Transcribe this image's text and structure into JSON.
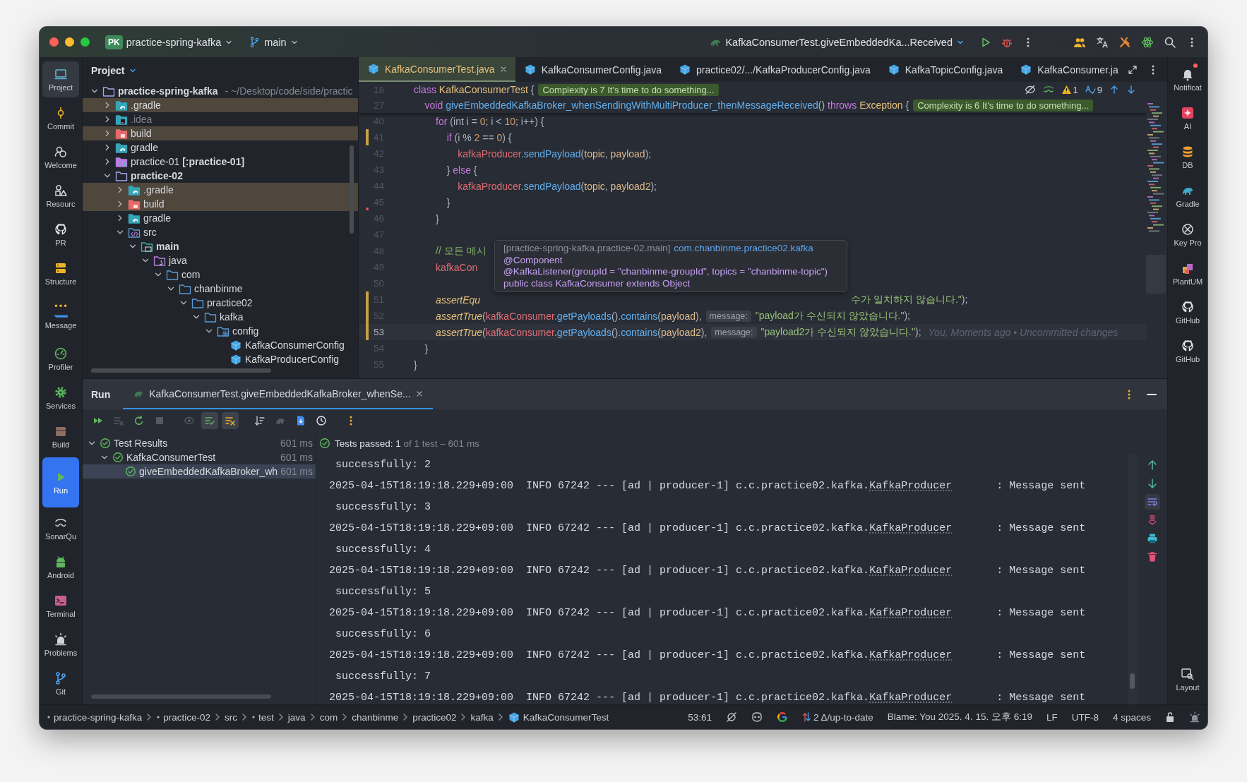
{
  "title_bar": {
    "project_badge": "PK",
    "project": "practice-spring-kafka",
    "branch": "main",
    "run_config": "KafkaConsumerTest.giveEmbeddedKa...Received"
  },
  "left_toolbar": [
    {
      "label": "Project",
      "selected": true
    },
    {
      "label": "Commit",
      "selected": false
    },
    {
      "label": "Welcome",
      "selected": false
    },
    {
      "label": "Resourc",
      "selected": false
    },
    {
      "label": "PR",
      "selected": false
    },
    {
      "label": "Structure",
      "selected": false
    },
    {
      "label": "Message",
      "selected": false
    },
    {
      "label": "Profiler",
      "selected": false
    },
    {
      "label": "Services",
      "selected": false
    },
    {
      "label": "Build",
      "selected": false
    },
    {
      "label": "Run",
      "selected": true
    },
    {
      "label": "SonarQu",
      "selected": false
    },
    {
      "label": "Android",
      "selected": false
    },
    {
      "label": "Terminal",
      "selected": false
    },
    {
      "label": "Problems",
      "selected": false
    },
    {
      "label": "Git",
      "selected": false
    }
  ],
  "right_toolbar": [
    {
      "label": "Notificat",
      "unread": true
    },
    {
      "label": "AI",
      "unread": false
    },
    {
      "label": "DB",
      "unread": false
    },
    {
      "label": "Gradle",
      "unread": false
    },
    {
      "label": "Key Pro",
      "unread": false
    },
    {
      "label": "PlantUM",
      "unread": false
    },
    {
      "label": "GitHub",
      "unread": false
    },
    {
      "label": "GitHub",
      "unread": false
    }
  ],
  "layout_button": "Layout",
  "project_panel": {
    "title": "Project",
    "tree": [
      {
        "kind": "project",
        "label": "practice-spring-kafka",
        "path": "- ~/Desktop/code/side/practic",
        "expanded": true,
        "excluded": false,
        "ignored": false,
        "children": [
          {
            "kind": "gradle_folder",
            "label": ".gradle",
            "expanded": false,
            "excluded": true,
            "ignored": false
          },
          {
            "kind": "idea_folder",
            "label": ".idea",
            "expanded": false,
            "excluded": false,
            "ignored": true
          },
          {
            "kind": "build_folder",
            "label": "build",
            "expanded": false,
            "excluded": true,
            "ignored": false
          },
          {
            "kind": "gradle_folder",
            "label": "gradle",
            "expanded": false,
            "excluded": false,
            "ignored": false
          },
          {
            "kind": "module_ref",
            "label": "practice-01 **[:practice-01]**",
            "expanded": false,
            "excluded": false,
            "ignored": false
          },
          {
            "kind": "module",
            "label": "practice-02",
            "expanded": true,
            "excluded": false,
            "ignored": false,
            "children": [
              {
                "kind": "gradle_folder",
                "label": ".gradle",
                "expanded": false,
                "excluded": true,
                "ignored": false
              },
              {
                "kind": "build_folder",
                "label": "build",
                "expanded": false,
                "excluded": true,
                "ignored": false
              },
              {
                "kind": "gradle_folder",
                "label": "gradle",
                "expanded": false,
                "excluded": false,
                "ignored": false
              },
              {
                "kind": "src",
                "label": "src",
                "expanded": true,
                "excluded": false,
                "ignored": false,
                "children": [
                  {
                    "kind": "source_set",
                    "label": "main",
                    "expanded": true,
                    "excluded": false,
                    "ignored": false,
                    "children": [
                      {
                        "kind": "java",
                        "label": "java",
                        "expanded": true,
                        "excluded": false,
                        "ignored": false,
                        "children": [
                          {
                            "kind": "package",
                            "label": "com",
                            "expanded": true,
                            "excluded": false,
                            "ignored": false,
                            "children": [
                              {
                                "kind": "package",
                                "label": "chanbinme",
                                "expanded": true,
                                "excluded": false,
                                "ignored": false,
                                "children": [
                                  {
                                    "kind": "package",
                                    "label": "practice02",
                                    "expanded": true,
                                    "excluded": false,
                                    "ignored": false,
                                    "children": [
                                      {
                                        "kind": "package",
                                        "label": "kafka",
                                        "expanded": true,
                                        "excluded": false,
                                        "ignored": false,
                                        "children": [
                                          {
                                            "kind": "config",
                                            "label": "config",
                                            "expanded": true,
                                            "excluded": false,
                                            "ignored": false,
                                            "children": [
                                              {
                                                "kind": "class",
                                                "label": "KafkaConsumerConfig",
                                                "excluded": false,
                                                "ignored": false
                                              },
                                              {
                                                "kind": "class",
                                                "label": "KafkaProducerConfig",
                                                "excluded": false,
                                                "ignored": false
                                              }
                                            ]
                                          }
                                        ]
                                      }
                                    ]
                                  }
                                ]
                              }
                            ]
                          }
                        ]
                      }
                    ]
                  }
                ]
              }
            ]
          }
        ]
      }
    ]
  },
  "editor": {
    "tabs": [
      {
        "label": "KafkaConsumerTest.java",
        "selected": true
      },
      {
        "label": "KafkaConsumerConfig.java",
        "selected": false
      },
      {
        "label": "practice02/.../KafkaProducerConfig.java",
        "selected": false
      },
      {
        "label": "KafkaTopicConfig.java",
        "selected": false
      },
      {
        "label": "KafkaConsumer.ja",
        "selected": false
      }
    ],
    "inspections": {
      "warnings": "1",
      "typos": "9"
    },
    "sticky_lines": [
      {
        "number": "18",
        "tokens": [
          {
            "kind": "kw",
            "text": "class "
          },
          {
            "kind": "type",
            "text": "KafkaConsumerTest "
          },
          {
            "kind": "p",
            "text": "{"
          },
          {
            "kind": "badge",
            "text": "Complexity is 7 It's time to do something..."
          }
        ]
      },
      {
        "number": "27",
        "tokens": [
          {
            "kind": "kw",
            "text": "    void "
          },
          {
            "kind": "fn",
            "text": "giveEmbeddedKafkaBroker_whenSendingWithMultiProducer_thenMessageReceived"
          },
          {
            "kind": "p",
            "text": "() "
          },
          {
            "kind": "kw",
            "text": "throws "
          },
          {
            "kind": "type",
            "text": "Exception "
          },
          {
            "kind": "p",
            "text": "{"
          },
          {
            "kind": "badge",
            "text": "Complexity is 6 It's time to do something..."
          }
        ]
      }
    ],
    "lines": [
      {
        "number": "40",
        "modified": false,
        "deleted": false,
        "current": false,
        "tokens": [
          {
            "kind": "kw",
            "text": "        for "
          },
          {
            "kind": "p",
            "text": "(int i = "
          },
          {
            "kind": "num",
            "text": "0"
          },
          {
            "kind": "p",
            "text": "; i < "
          },
          {
            "kind": "num",
            "text": "10"
          },
          {
            "kind": "p",
            "text": "; i++) {"
          }
        ]
      },
      {
        "number": "41",
        "modified": true,
        "deleted": false,
        "current": false,
        "tokens": [
          {
            "kind": "kw",
            "text": "            if "
          },
          {
            "kind": "p",
            "text": "(i % "
          },
          {
            "kind": "num",
            "text": "2"
          },
          {
            "kind": "p",
            "text": " == "
          },
          {
            "kind": "num",
            "text": "0"
          },
          {
            "kind": "p",
            "text": ") {"
          }
        ]
      },
      {
        "number": "42",
        "modified": false,
        "deleted": false,
        "current": false,
        "tokens": [
          {
            "kind": "var",
            "text": "                kafkaProducer"
          },
          {
            "kind": "p",
            "text": "."
          },
          {
            "kind": "fn",
            "text": "sendPayload"
          },
          {
            "kind": "p",
            "text": "("
          },
          {
            "kind": "arg",
            "text": "topic"
          },
          {
            "kind": "p",
            "text": ", "
          },
          {
            "kind": "arg",
            "text": "payload"
          },
          {
            "kind": "p",
            "text": ");"
          }
        ]
      },
      {
        "number": "43",
        "modified": false,
        "deleted": false,
        "current": false,
        "tokens": [
          {
            "kind": "p",
            "text": "            } "
          },
          {
            "kind": "kw",
            "text": "else "
          },
          {
            "kind": "p",
            "text": "{"
          }
        ]
      },
      {
        "number": "44",
        "modified": false,
        "deleted": false,
        "current": false,
        "tokens": [
          {
            "kind": "var",
            "text": "                kafkaProducer"
          },
          {
            "kind": "p",
            "text": "."
          },
          {
            "kind": "fn",
            "text": "sendPayload"
          },
          {
            "kind": "p",
            "text": "("
          },
          {
            "kind": "arg",
            "text": "topic"
          },
          {
            "kind": "p",
            "text": ", "
          },
          {
            "kind": "arg",
            "text": "payload2"
          },
          {
            "kind": "p",
            "text": ");"
          }
        ]
      },
      {
        "number": "45",
        "modified": false,
        "deleted": true,
        "current": false,
        "tokens": [
          {
            "kind": "p",
            "text": "            }"
          }
        ]
      },
      {
        "number": "46",
        "modified": false,
        "deleted": false,
        "current": false,
        "tokens": [
          {
            "kind": "p",
            "text": "        }"
          }
        ]
      },
      {
        "number": "47",
        "modified": false,
        "deleted": false,
        "current": false
      },
      {
        "number": "48",
        "modified": false,
        "deleted": false,
        "current": false,
        "tokens": [
          {
            "kind": "cmt",
            "text": "        // 모든 메시"
          }
        ]
      },
      {
        "number": "49",
        "modified": false,
        "deleted": false,
        "current": false,
        "tokens": [
          {
            "kind": "var",
            "text": "        kafkaCon"
          }
        ]
      },
      {
        "number": "50",
        "modified": false,
        "deleted": false,
        "current": false
      },
      {
        "number": "51",
        "modified": true,
        "deleted": false,
        "current": false,
        "tokens": [
          {
            "kind": "call",
            "text": "        assertEqu"
          },
          {
            "kind": "str",
            "text": "수가 일치하지 않습니다.\"",
            "after_popup": true
          },
          {
            "kind": "p",
            "text": ");"
          }
        ]
      },
      {
        "number": "52",
        "modified": true,
        "deleted": false,
        "current": false,
        "tokens": [
          {
            "kind": "call",
            "text": "        assertTrue"
          },
          {
            "kind": "p",
            "text": "("
          },
          {
            "kind": "var",
            "text": "kafkaConsumer"
          },
          {
            "kind": "p",
            "text": "."
          },
          {
            "kind": "fn",
            "text": "getPayloads"
          },
          {
            "kind": "p",
            "text": "()."
          },
          {
            "kind": "fn",
            "text": "contains"
          },
          {
            "kind": "p",
            "text": "("
          },
          {
            "kind": "arg",
            "text": "payload"
          },
          {
            "kind": "p",
            "text": "),"
          },
          {
            "kind": "hint",
            "text": "message:"
          },
          {
            "kind": "str",
            "text": "\"payload가 수신되지 않았습니다.\""
          },
          {
            "kind": "p",
            "text": ");"
          }
        ]
      },
      {
        "number": "53",
        "modified": true,
        "deleted": false,
        "current": true,
        "tokens": [
          {
            "kind": "call",
            "text": "        assertTrue"
          },
          {
            "kind": "p",
            "text": "("
          },
          {
            "kind": "var",
            "text": "kafkaConsumer"
          },
          {
            "kind": "p",
            "text": "."
          },
          {
            "kind": "fn",
            "text": "getPayloads"
          },
          {
            "kind": "p",
            "text": "()."
          },
          {
            "kind": "fn",
            "text": "contains"
          },
          {
            "kind": "p",
            "text": "("
          },
          {
            "kind": "arg",
            "text": "payload2"
          },
          {
            "kind": "p",
            "text": "),"
          },
          {
            "kind": "hint",
            "text": "message:"
          },
          {
            "kind": "str",
            "text": "\"payload2가 수신되지 않았습니다.\""
          },
          {
            "kind": "p",
            "text": ");"
          },
          {
            "kind": "ghost",
            "text": "You, Moments ago • Uncommitted changes"
          }
        ]
      },
      {
        "number": "54",
        "modified": false,
        "deleted": false,
        "current": false,
        "tokens": [
          {
            "kind": "p",
            "text": "    }"
          }
        ]
      },
      {
        "number": "55",
        "modified": false,
        "deleted": false,
        "current": false,
        "tokens": [
          {
            "kind": "p",
            "text": "}"
          }
        ]
      }
    ],
    "popup": {
      "module": "[practice-spring-kafka.practice-02.main]",
      "package": "com.chanbinme.practice02.kafka",
      "signature": [
        "@Component",
        "@KafkaListener(groupId = \"chanbinme-groupId\", topics = \"chanbinme-topic\")",
        "public class KafkaConsumer extends Object"
      ]
    }
  },
  "run_panel": {
    "title": "Run",
    "tabs": [
      {
        "label": "KafkaConsumerTest.giveEmbeddedKafkaBroker_whenSe...",
        "selected": true
      }
    ],
    "toolbar": [
      {
        "toggled": false,
        "disabled": false
      },
      {
        "toggled": false,
        "disabled": true
      },
      {
        "toggled": false,
        "disabled": false
      },
      {
        "toggled": false,
        "disabled": true
      },
      {
        "toggled": false,
        "disabled": true
      },
      {
        "toggled": true,
        "disabled": false
      },
      {
        "toggled": true,
        "disabled": false
      },
      {
        "toggled": false,
        "disabled": false
      },
      {
        "toggled": false,
        "disabled": true
      },
      {
        "toggled": false,
        "disabled": false
      },
      {
        "toggled": false,
        "disabled": false
      },
      {
        "toggled": false,
        "disabled": false
      }
    ],
    "tests": [
      {
        "label": "Test Results",
        "passed": true,
        "time": "601 ms",
        "expanded": true,
        "selected": false,
        "children": [
          {
            "label": "KafkaConsumerTest",
            "passed": true,
            "time": "601 ms",
            "expanded": true,
            "selected": false,
            "children": [
              {
                "label": "giveEmbeddedKafkaBroker_wh",
                "passed": true,
                "time": "601 ms",
                "selected": true
              }
            ]
          }
        ]
      }
    ],
    "summary": "**Tests passed: 1** of 1 test – 601 ms",
    "console": [
      {
        "kind": "text",
        "text": " successfully: 2"
      },
      {
        "kind": "log",
        "prefix": "2025-04-15T18:19:18.229+09:00  INFO 67242 --- [ad | producer-1] c.c.practice02.kafka.",
        "link": "KafkaProducer",
        "suffix": "       : Message sent"
      },
      {
        "kind": "text",
        "text": " successfully: 3"
      },
      {
        "kind": "log",
        "prefix": "2025-04-15T18:19:18.229+09:00  INFO 67242 --- [ad | producer-1] c.c.practice02.kafka.",
        "link": "KafkaProducer",
        "suffix": "       : Message sent"
      },
      {
        "kind": "text",
        "text": " successfully: 4"
      },
      {
        "kind": "log",
        "prefix": "2025-04-15T18:19:18.229+09:00  INFO 67242 --- [ad | producer-1] c.c.practice02.kafka.",
        "link": "KafkaProducer",
        "suffix": "       : Message sent"
      },
      {
        "kind": "text",
        "text": " successfully: 5"
      },
      {
        "kind": "log",
        "prefix": "2025-04-15T18:19:18.229+09:00  INFO 67242 --- [ad | producer-1] c.c.practice02.kafka.",
        "link": "KafkaProducer",
        "suffix": "       : Message sent"
      },
      {
        "kind": "text",
        "text": " successfully: 6"
      },
      {
        "kind": "log",
        "prefix": "2025-04-15T18:19:18.229+09:00  INFO 67242 --- [ad | producer-1] c.c.practice02.kafka.",
        "link": "KafkaProducer",
        "suffix": "       : Message sent"
      },
      {
        "kind": "text",
        "text": " successfully: 7"
      },
      {
        "kind": "log",
        "prefix": "2025-04-15T18:19:18.229+09:00  INFO 67242 --- [ad | producer-1] c.c.practice02.kafka.",
        "link": "KafkaProducer",
        "suffix": "       : Message sent"
      }
    ]
  },
  "status_bar": {
    "breadcrumbs": [
      {
        "kind": "module",
        "label": "practice-spring-kafka"
      },
      {
        "kind": "module",
        "label": "practice-02"
      },
      {
        "kind": "folder",
        "label": "src"
      },
      {
        "kind": "module",
        "label": "test"
      },
      {
        "kind": "folder",
        "label": "java"
      },
      {
        "kind": "folder",
        "label": "com"
      },
      {
        "kind": "folder",
        "label": "chanbinme"
      },
      {
        "kind": "folder",
        "label": "practice02"
      },
      {
        "kind": "folder",
        "label": "kafka"
      },
      {
        "kind": "class",
        "label": "KafkaConsumerTest"
      }
    ],
    "position": "53:61",
    "vcs": "2 Δ/up-to-date",
    "blame": "Blame: You 2025. 4. 15. 오후 6:19",
    "line_separator": "LF",
    "encoding": "UTF-8",
    "indent": "4 spaces"
  }
}
